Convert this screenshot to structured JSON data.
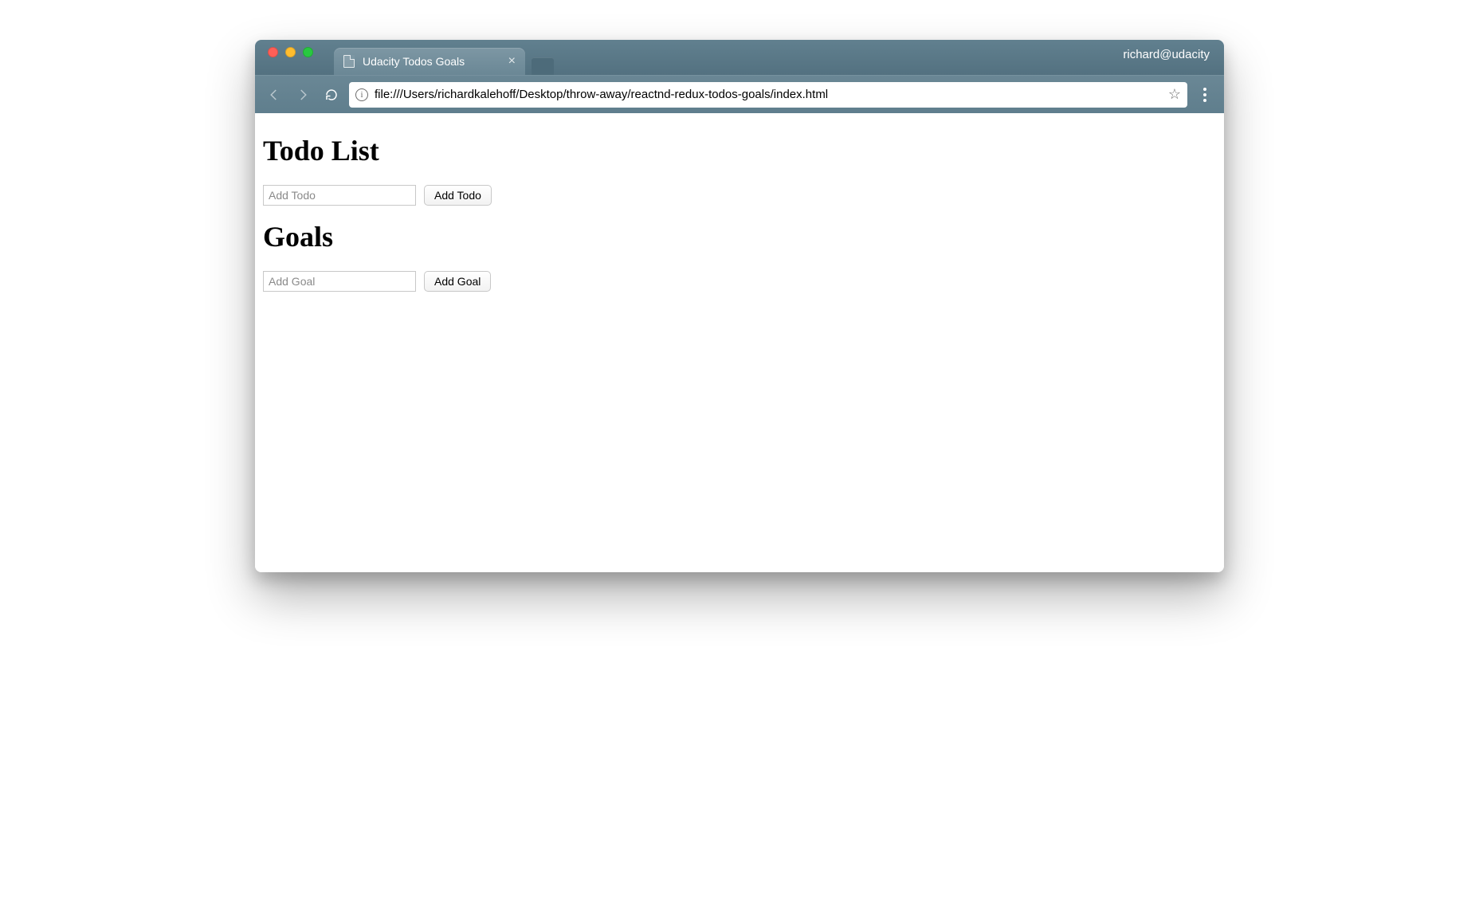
{
  "chrome": {
    "tab_title": "Udacity Todos Goals",
    "user_label": "richard@udacity",
    "url": "file:///Users/richardkalehoff/Desktop/throw-away/reactnd-redux-todos-goals/index.html"
  },
  "page": {
    "todos": {
      "heading": "Todo List",
      "input_placeholder": "Add Todo",
      "button_label": "Add Todo"
    },
    "goals": {
      "heading": "Goals",
      "input_placeholder": "Add Goal",
      "button_label": "Add Goal"
    }
  }
}
